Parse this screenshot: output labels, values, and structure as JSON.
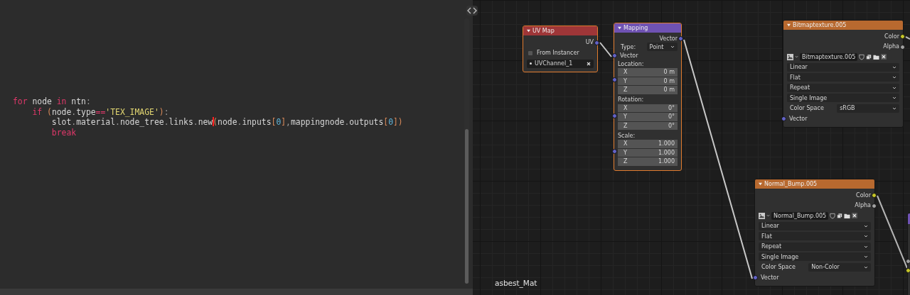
{
  "code_editor": {
    "lines": [
      {
        "tokens": [
          {
            "kind": "keyword",
            "text": "for"
          },
          {
            "kind": "plain",
            "text": " node "
          },
          {
            "kind": "keyword",
            "text": "in"
          },
          {
            "kind": "plain",
            "text": " ntn"
          },
          {
            "kind": "punct",
            "text": ":"
          }
        ]
      },
      {
        "tokens": [
          {
            "kind": "keyword",
            "text": "    if "
          },
          {
            "kind": "bracket",
            "text": "("
          },
          {
            "kind": "plain",
            "text": "node"
          },
          {
            "kind": "punct",
            "text": "."
          },
          {
            "kind": "plain",
            "text": "type"
          },
          {
            "kind": "operator",
            "text": "=="
          },
          {
            "kind": "string",
            "text": "'TEX_IMAGE'"
          },
          {
            "kind": "bracket",
            "text": ")"
          },
          {
            "kind": "punct",
            "text": ":"
          }
        ]
      },
      {
        "tokens": [
          {
            "kind": "plain",
            "text": "        slot"
          },
          {
            "kind": "punct",
            "text": "."
          },
          {
            "kind": "plain",
            "text": "material"
          },
          {
            "kind": "punct",
            "text": "."
          },
          {
            "kind": "plain",
            "text": "node_tree"
          },
          {
            "kind": "punct",
            "text": "."
          },
          {
            "kind": "plain",
            "text": "links"
          },
          {
            "kind": "punct",
            "text": "."
          },
          {
            "kind": "plain",
            "text": "new"
          },
          {
            "kind": "cursor"
          },
          {
            "kind": "bracket",
            "text": "("
          },
          {
            "kind": "plain",
            "text": "node"
          },
          {
            "kind": "punct",
            "text": "."
          },
          {
            "kind": "plain",
            "text": "inputs"
          },
          {
            "kind": "bracket",
            "text": "["
          },
          {
            "kind": "number",
            "text": "0"
          },
          {
            "kind": "bracket",
            "text": "]"
          },
          {
            "kind": "punct",
            "text": ","
          },
          {
            "kind": "plain",
            "text": "mappingnode"
          },
          {
            "kind": "punct",
            "text": "."
          },
          {
            "kind": "plain",
            "text": "outputs"
          },
          {
            "kind": "bracket",
            "text": "["
          },
          {
            "kind": "number",
            "text": "0"
          },
          {
            "kind": "bracket",
            "text": "])"
          }
        ]
      },
      {
        "tokens": [
          {
            "kind": "keyword",
            "text": "        break"
          }
        ]
      }
    ]
  },
  "node_editor": {
    "material": "asbest_Mat",
    "nodes": [
      {
        "kind": "node",
        "title": "UV Map",
        "color": "#9e3638",
        "selected": true,
        "rows": [
          {
            "kind": "output",
            "label": "UV",
            "color": "#6363c7"
          },
          {
            "kind": "checkbox",
            "label": "From Instancer",
            "checked": false
          },
          {
            "kind": "field",
            "value": "UVChannel_1"
          }
        ]
      },
      {
        "kind": "node",
        "title": "Mapping",
        "color": "#6f52b3",
        "selected": true,
        "rows": [
          {
            "kind": "output",
            "label": "Vector",
            "color": "#6363c7"
          },
          {
            "kind": "labeled-dropdown",
            "label": "Type:",
            "value": "Point"
          },
          {
            "kind": "input",
            "label": "Vector",
            "color": "#6363c7"
          },
          {
            "kind": "vector",
            "label": "Location:",
            "color": "#6363c7",
            "axes": [
              {
                "axis": "X",
                "value": "0 m"
              },
              {
                "axis": "Y",
                "value": "0 m"
              },
              {
                "axis": "Z",
                "value": "0 m"
              }
            ]
          },
          {
            "kind": "vector",
            "label": "Rotation:",
            "color": "#6363c7",
            "axes": [
              {
                "axis": "X",
                "value": "0°"
              },
              {
                "axis": "Y",
                "value": "0°"
              },
              {
                "axis": "Z",
                "value": "0°"
              }
            ]
          },
          {
            "kind": "vector",
            "label": "Scale:",
            "color": "#6363c7",
            "axes": [
              {
                "axis": "X",
                "value": "1.000"
              },
              {
                "axis": "Y",
                "value": "1.000"
              },
              {
                "axis": "Z",
                "value": "1.000"
              }
            ]
          }
        ]
      },
      {
        "kind": "node",
        "title": "Bitmaptexture.005",
        "color": "#b8692f",
        "selected": false,
        "rows": [
          {
            "kind": "output",
            "label": "Color",
            "color": "#c7c729"
          },
          {
            "kind": "output",
            "label": "Alpha",
            "color": "#a1a1a1"
          },
          {
            "kind": "image",
            "value": "Bitmaptexture.005"
          },
          {
            "kind": "dropdown",
            "value": "Linear"
          },
          {
            "kind": "dropdown",
            "value": "Flat"
          },
          {
            "kind": "dropdown",
            "value": "Repeat"
          },
          {
            "kind": "dropdown",
            "value": "Single Image"
          },
          {
            "kind": "labeled-dropdown",
            "label": "Color Space",
            "value": "sRGB"
          },
          {
            "kind": "input",
            "label": "Vector",
            "color": "#6363c7"
          }
        ]
      },
      {
        "kind": "node",
        "title": "Normal_Bump.005",
        "color": "#b8692f",
        "selected": false,
        "rows": [
          {
            "kind": "output",
            "label": "Color",
            "color": "#c7c729"
          },
          {
            "kind": "output",
            "label": "Alpha",
            "color": "#a1a1a1"
          },
          {
            "kind": "image",
            "value": "Normal_Bump.005"
          },
          {
            "kind": "dropdown",
            "value": "Linear"
          },
          {
            "kind": "dropdown",
            "value": "Flat"
          },
          {
            "kind": "dropdown",
            "value": "Repeat"
          },
          {
            "kind": "dropdown",
            "value": "Single Image"
          },
          {
            "kind": "labeled-dropdown",
            "label": "Color Space",
            "value": "Non-Color"
          },
          {
            "kind": "input",
            "label": "Vector",
            "color": "#6363c7"
          }
        ]
      },
      {
        "kind": "clipped",
        "color": "#6f52b3",
        "selected": false
      }
    ]
  }
}
